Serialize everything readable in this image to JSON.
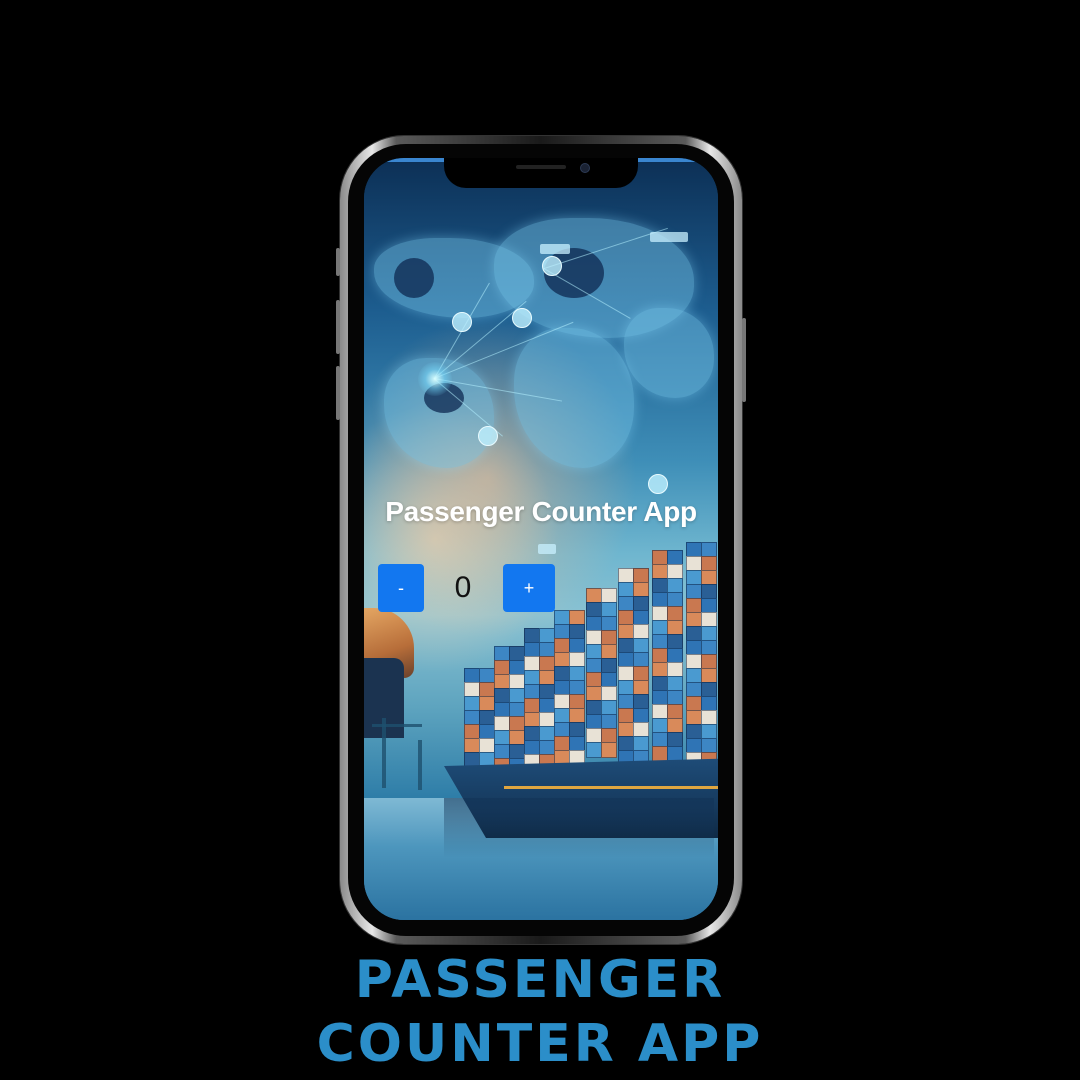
{
  "app": {
    "title": "Passenger Counter App",
    "decrement_label": "-",
    "count": "0",
    "increment_label": "+",
    "button_color": "#1277f0"
  },
  "promo": {
    "line1": "Passenger",
    "line2": "Counter App",
    "color": "#2b8ec9"
  },
  "background": {
    "description_icon": "world-map-shipping-background"
  }
}
